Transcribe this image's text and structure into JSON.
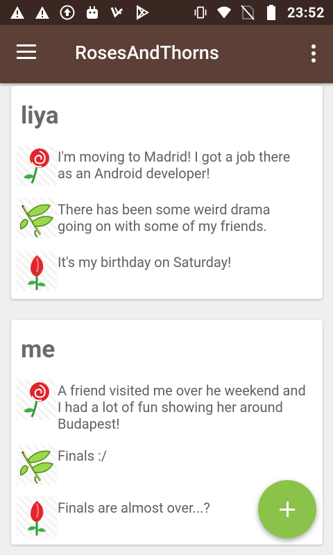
{
  "status_bar": {
    "time": "23:52",
    "left_icons": [
      "warning-icon",
      "warning-icon",
      "upload-icon",
      "android-icon",
      "download-icon",
      "play-store-icon"
    ],
    "right_icons": [
      "vibrate-icon",
      "wifi-icon",
      "no-sim-icon",
      "battery-icon"
    ]
  },
  "toolbar": {
    "title": "RosesAndThorns",
    "nav_icon": "hamburger-menu-icon",
    "overflow_icon": "more-vert-icon",
    "color": "#5c4037"
  },
  "cards": [
    {
      "name": "liya",
      "entries": [
        {
          "type": "rose-icon",
          "text": "I'm moving to Madrid! I got a job there as an Android developer!"
        },
        {
          "type": "thorn-icon",
          "text": "There has been some weird drama going on with some of my friends."
        },
        {
          "type": "bud-icon",
          "text": "It's my birthday on Saturday!"
        }
      ]
    },
    {
      "name": "me",
      "entries": [
        {
          "type": "rose-icon",
          "text": "A friend visited me over he weekend and I had a lot of fun showing her around Budapest!"
        },
        {
          "type": "thorn-icon",
          "text": "Finals :/"
        },
        {
          "type": "bud-icon",
          "text": "Finals are almost over...?"
        }
      ]
    }
  ],
  "fab": {
    "icon": "plus-icon",
    "color": "#8bc34a"
  }
}
